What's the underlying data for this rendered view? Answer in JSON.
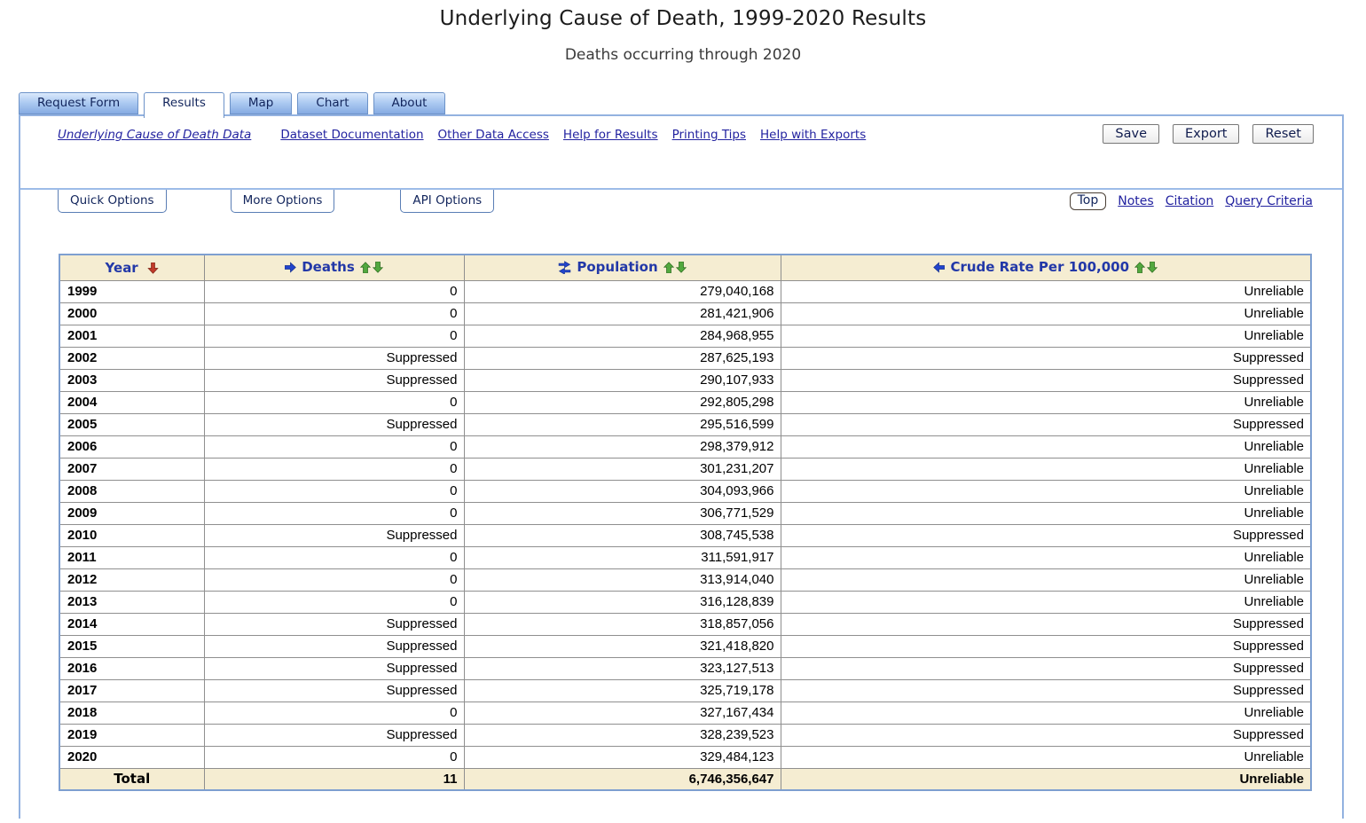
{
  "page": {
    "title": "Underlying Cause of Death, 1999-2020 Results",
    "subtitle": "Deaths occurring through 2020"
  },
  "tabs": [
    {
      "label": "Request Form",
      "active": false
    },
    {
      "label": "Results",
      "active": true
    },
    {
      "label": "Map",
      "active": false
    },
    {
      "label": "Chart",
      "active": false
    },
    {
      "label": "About",
      "active": false
    }
  ],
  "links": {
    "dataset": "Underlying Cause of Death Data",
    "items": [
      "Dataset Documentation",
      "Other Data Access",
      "Help for Results",
      "Printing Tips",
      "Help with Exports"
    ]
  },
  "actions": {
    "save": "Save",
    "export": "Export",
    "reset": "Reset"
  },
  "option_tabs": [
    "Quick Options",
    "More Options",
    "API Options"
  ],
  "nav_right": {
    "top": "Top",
    "notes": "Notes",
    "citation": "Citation",
    "query_criteria": "Query Criteria"
  },
  "table": {
    "columns": [
      {
        "label": "Year",
        "icons": [
          "sort-desc-red-icon"
        ]
      },
      {
        "label": "Deaths",
        "icons": [
          "arrow-right-blue-icon",
          "sort-asc-green-icon",
          "sort-desc-green-icon"
        ]
      },
      {
        "label": "Population",
        "icons": [
          "swap-blue-icon",
          "sort-asc-green-icon",
          "sort-desc-green-icon"
        ]
      },
      {
        "label": "Crude Rate Per 100,000",
        "icons": [
          "arrow-left-blue-icon",
          "sort-asc-green-icon",
          "sort-desc-green-icon"
        ]
      }
    ],
    "rows": [
      {
        "year": "1999",
        "deaths": "0",
        "population": "279,040,168",
        "crude_rate": "Unreliable"
      },
      {
        "year": "2000",
        "deaths": "0",
        "population": "281,421,906",
        "crude_rate": "Unreliable"
      },
      {
        "year": "2001",
        "deaths": "0",
        "population": "284,968,955",
        "crude_rate": "Unreliable"
      },
      {
        "year": "2002",
        "deaths": "Suppressed",
        "population": "287,625,193",
        "crude_rate": "Suppressed"
      },
      {
        "year": "2003",
        "deaths": "Suppressed",
        "population": "290,107,933",
        "crude_rate": "Suppressed"
      },
      {
        "year": "2004",
        "deaths": "0",
        "population": "292,805,298",
        "crude_rate": "Unreliable"
      },
      {
        "year": "2005",
        "deaths": "Suppressed",
        "population": "295,516,599",
        "crude_rate": "Suppressed"
      },
      {
        "year": "2006",
        "deaths": "0",
        "population": "298,379,912",
        "crude_rate": "Unreliable"
      },
      {
        "year": "2007",
        "deaths": "0",
        "population": "301,231,207",
        "crude_rate": "Unreliable"
      },
      {
        "year": "2008",
        "deaths": "0",
        "population": "304,093,966",
        "crude_rate": "Unreliable"
      },
      {
        "year": "2009",
        "deaths": "0",
        "population": "306,771,529",
        "crude_rate": "Unreliable"
      },
      {
        "year": "2010",
        "deaths": "Suppressed",
        "population": "308,745,538",
        "crude_rate": "Suppressed"
      },
      {
        "year": "2011",
        "deaths": "0",
        "population": "311,591,917",
        "crude_rate": "Unreliable"
      },
      {
        "year": "2012",
        "deaths": "0",
        "population": "313,914,040",
        "crude_rate": "Unreliable"
      },
      {
        "year": "2013",
        "deaths": "0",
        "population": "316,128,839",
        "crude_rate": "Unreliable"
      },
      {
        "year": "2014",
        "deaths": "Suppressed",
        "population": "318,857,056",
        "crude_rate": "Suppressed"
      },
      {
        "year": "2015",
        "deaths": "Suppressed",
        "population": "321,418,820",
        "crude_rate": "Suppressed"
      },
      {
        "year": "2016",
        "deaths": "Suppressed",
        "population": "323,127,513",
        "crude_rate": "Suppressed"
      },
      {
        "year": "2017",
        "deaths": "Suppressed",
        "population": "325,719,178",
        "crude_rate": "Suppressed"
      },
      {
        "year": "2018",
        "deaths": "0",
        "population": "327,167,434",
        "crude_rate": "Unreliable"
      },
      {
        "year": "2019",
        "deaths": "Suppressed",
        "population": "328,239,523",
        "crude_rate": "Suppressed"
      },
      {
        "year": "2020",
        "deaths": "0",
        "population": "329,484,123",
        "crude_rate": "Unreliable"
      }
    ],
    "total": {
      "label": "Total",
      "deaths": "11",
      "population": "6,746,356,647",
      "crude_rate": "Unreliable"
    }
  },
  "colors": {
    "tab_gradient_top": "#dbe9fb",
    "tab_gradient_bottom": "#86abe2",
    "content_border": "#93b2e0",
    "table_border": "#7e9fd0",
    "header_bg": "#f5edd2",
    "header_text_blue": "#2238a8",
    "link_blue": "#2323a0",
    "arrow_blue": "#2244cc",
    "arrow_green": "#52a83e",
    "arrow_red": "#c13b2a"
  }
}
